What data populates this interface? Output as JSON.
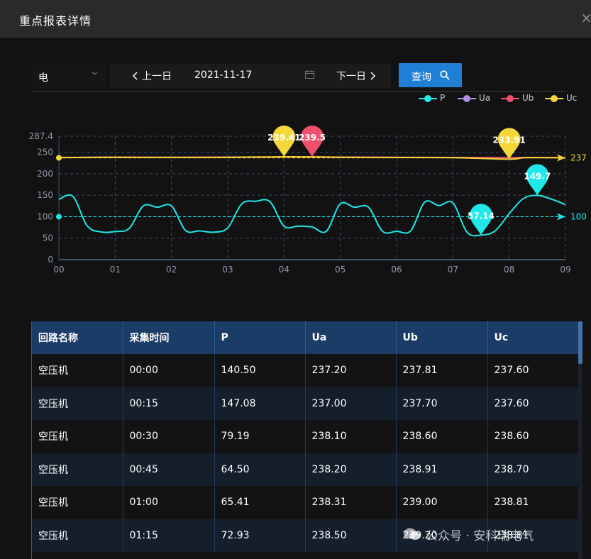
{
  "modal": {
    "title": "重点报表详情",
    "close_glyph": "×"
  },
  "toolbar": {
    "type_value": "电",
    "chevron_icon": "chevron-down-icon",
    "prev_label": "上一日",
    "date": "2021-11-17",
    "calendar_icon": "calendar-icon",
    "next_label": "下一日",
    "query_label": "查询",
    "search_icon": "search-icon"
  },
  "legend": [
    {
      "name": "P",
      "color": "#1ee8e8"
    },
    {
      "name": "Ua",
      "color": "#b28fe0"
    },
    {
      "name": "Ub",
      "color": "#f0506e"
    },
    {
      "name": "Uc",
      "color": "#f5d63b"
    }
  ],
  "chart_data": {
    "type": "line",
    "x_ticks": [
      "00",
      "01",
      "02",
      "03",
      "04",
      "05",
      "06",
      "07",
      "08",
      "09"
    ],
    "y_ticks": [
      0,
      50,
      100,
      150,
      200,
      250,
      287.4
    ],
    "ylim": [
      0,
      287.4
    ],
    "xlim": [
      0,
      9
    ],
    "grid": true,
    "legend_position": "top-right",
    "series": [
      {
        "name": "P",
        "color": "#1ee8e8",
        "points": [
          [
            0,
            140.5
          ],
          [
            0.25,
            147.1
          ],
          [
            0.5,
            79.2
          ],
          [
            0.75,
            64.5
          ],
          [
            1.0,
            65.4
          ],
          [
            1.25,
            72.9
          ],
          [
            1.5,
            125
          ],
          [
            1.75,
            122
          ],
          [
            2.0,
            125
          ],
          [
            2.25,
            68
          ],
          [
            2.5,
            67
          ],
          [
            2.75,
            64
          ],
          [
            3.0,
            74
          ],
          [
            3.25,
            130
          ],
          [
            3.5,
            136
          ],
          [
            3.75,
            135
          ],
          [
            4.0,
            78
          ],
          [
            4.25,
            78
          ],
          [
            4.5,
            76
          ],
          [
            4.75,
            66
          ],
          [
            5.0,
            130
          ],
          [
            5.25,
            122
          ],
          [
            5.5,
            122
          ],
          [
            5.75,
            66
          ],
          [
            6.0,
            66
          ],
          [
            6.25,
            67
          ],
          [
            6.5,
            134
          ],
          [
            6.75,
            126
          ],
          [
            7.0,
            132
          ],
          [
            7.25,
            64
          ],
          [
            7.5,
            57.14
          ],
          [
            7.75,
            67
          ],
          [
            8.0,
            107
          ],
          [
            8.25,
            142
          ],
          [
            8.5,
            149.7
          ],
          [
            8.75,
            141
          ],
          [
            9.0,
            128
          ]
        ],
        "mark_points": [
          {
            "x": 7.5,
            "y": 57.14,
            "label": "57.14"
          },
          {
            "x": 8.5,
            "y": 149.7,
            "label": "149.7"
          }
        ],
        "mark_line": {
          "value": 100,
          "label": "100"
        }
      },
      {
        "name": "Ub",
        "color": "#f0506e",
        "points": [
          [
            0,
            237.8
          ],
          [
            1,
            238.4
          ],
          [
            2,
            238.2
          ],
          [
            3,
            238.6
          ],
          [
            4,
            238.8
          ],
          [
            4.5,
            239.5
          ],
          [
            5,
            238.6
          ],
          [
            6,
            238.2
          ],
          [
            7,
            237.9
          ],
          [
            8,
            237.6
          ],
          [
            9,
            237.9
          ]
        ],
        "mark_points": [
          {
            "x": 4.5,
            "y": 239.5,
            "label": "239.5"
          }
        ]
      },
      {
        "name": "Uc",
        "color": "#f5d63b",
        "points": [
          [
            0,
            237.6
          ],
          [
            0.5,
            238.1
          ],
          [
            1,
            238.4
          ],
          [
            2,
            238.0
          ],
          [
            3,
            238.3
          ],
          [
            4,
            239.41
          ],
          [
            5,
            238.4
          ],
          [
            6,
            237.9
          ],
          [
            7,
            237.4
          ],
          [
            8,
            233.91
          ],
          [
            8.3,
            237.6
          ],
          [
            9,
            237.1
          ]
        ],
        "mark_points": [
          {
            "x": 4,
            "y": 239.41,
            "label": "239.41"
          },
          {
            "x": 8,
            "y": 233.91,
            "label": "233.91"
          }
        ],
        "mark_line": {
          "value": 237,
          "label": "237"
        }
      }
    ]
  },
  "table": {
    "headers": [
      "回路名称",
      "采集时间",
      "P",
      "Ua",
      "Ub",
      "Uc"
    ],
    "rows": [
      [
        "空压机",
        "00:00",
        "140.50",
        "237.20",
        "237.81",
        "237.60"
      ],
      [
        "空压机",
        "00:15",
        "147.08",
        "237.00",
        "237.70",
        "237.60"
      ],
      [
        "空压机",
        "00:30",
        "79.19",
        "238.10",
        "238.60",
        "238.60"
      ],
      [
        "空压机",
        "00:45",
        "64.50",
        "238.20",
        "238.91",
        "238.70"
      ],
      [
        "空压机",
        "01:00",
        "65.41",
        "238.31",
        "239.00",
        "238.81"
      ],
      [
        "空压机",
        "01:15",
        "72.93",
        "238.50",
        "239.20",
        "238.81"
      ]
    ]
  },
  "watermark": "公众号 · 安科瑞电气"
}
